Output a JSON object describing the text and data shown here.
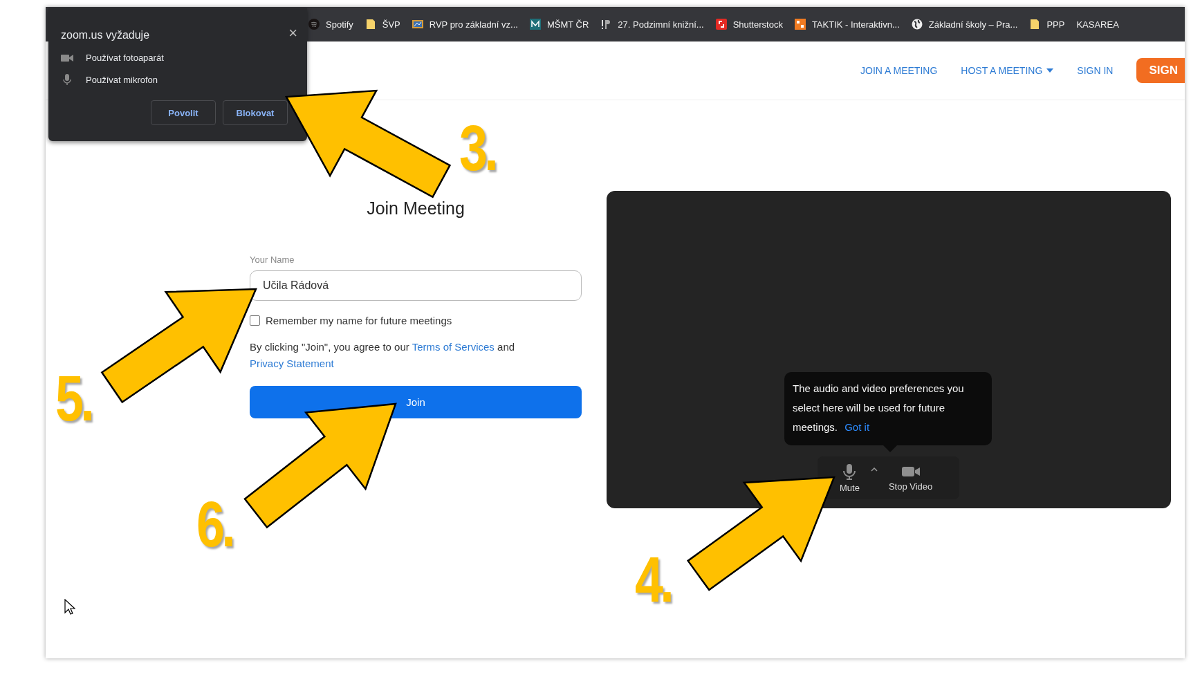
{
  "bookmarks": [
    {
      "label": "Spotify",
      "kind": "disc"
    },
    {
      "label": "ŠVP",
      "kind": "folder"
    },
    {
      "label": "RVP pro základní vz...",
      "kind": "tile"
    },
    {
      "label": "MŠMT ČR",
      "kind": "logo"
    },
    {
      "label": "27. Podzimní knižní...",
      "kind": "bars"
    },
    {
      "label": "Shutterstock",
      "kind": "red"
    },
    {
      "label": "TAKTIK - Interaktivn...",
      "kind": "orange"
    },
    {
      "label": "Základní školy – Pra...",
      "kind": "globe"
    },
    {
      "label": "PPP",
      "kind": "folder"
    },
    {
      "label": "KASAREA",
      "kind": "none"
    }
  ],
  "permission_popup": {
    "title": "zoom.us vyžaduje",
    "close": "×",
    "items": [
      {
        "kind": "camera",
        "label": "Používat fotoaparát"
      },
      {
        "kind": "mic",
        "label": "Používat mikrofon"
      }
    ],
    "buttons": [
      "Povolit",
      "Blokovat"
    ]
  },
  "nav": {
    "items": [
      {
        "label": "JOIN A MEETING",
        "dropdown": false
      },
      {
        "label": "HOST A MEETING",
        "dropdown": true
      },
      {
        "label": "SIGN IN",
        "dropdown": false
      }
    ],
    "cta": "SIGN"
  },
  "form": {
    "title": "Join Meeting",
    "name_label": "Your Name",
    "name_value": "Učila Rádová",
    "remember": {
      "label": "Remember my name for future meetings",
      "checked": false
    },
    "agreement": {
      "before": "By clicking \"Join\", you agree to our",
      "link1": "Terms of Services",
      "middle": "and",
      "link2": "Privacy Statement"
    },
    "join_button": "Join"
  },
  "preview": {
    "tooltip": {
      "text": "The audio and video preferences you select here will be used for future meetings.",
      "action": "Got it"
    },
    "controls": [
      {
        "kind": "mic",
        "label": "Mute"
      },
      {
        "kind": "video",
        "label": "Stop Video"
      }
    ]
  },
  "annotations": [
    {
      "number": "3."
    },
    {
      "number": "4."
    },
    {
      "number": "5."
    },
    {
      "number": "6."
    }
  ]
}
